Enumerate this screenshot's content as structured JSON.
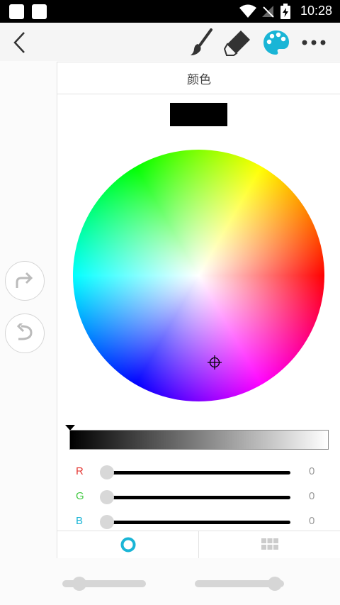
{
  "status_bar": {
    "time": "10:28"
  },
  "toolbar": {
    "icons": [
      "back-arrow-icon",
      "brush-icon",
      "eraser-icon",
      "palette-icon",
      "more-icon"
    ],
    "active_color": "#1ab5d6"
  },
  "panel": {
    "title": "颜色",
    "current_color": "#000000",
    "brightness": 0,
    "rgb": [
      {
        "label": "R",
        "value": "0",
        "color": "#e53935"
      },
      {
        "label": "G",
        "value": "0",
        "color": "#43c943"
      },
      {
        "label": "B",
        "value": "0",
        "color": "#1ab5d6"
      }
    ],
    "tabs": [
      {
        "icon": "color-wheel-tab-icon",
        "active": true
      },
      {
        "icon": "grid-tab-icon",
        "active": false
      }
    ]
  },
  "side_buttons": [
    "redo-icon",
    "undo-icon"
  ],
  "bottom_sliders": [
    {
      "name": "brush-size",
      "value": 0.2
    },
    {
      "name": "brush-opacity",
      "value": 0.9
    }
  ]
}
